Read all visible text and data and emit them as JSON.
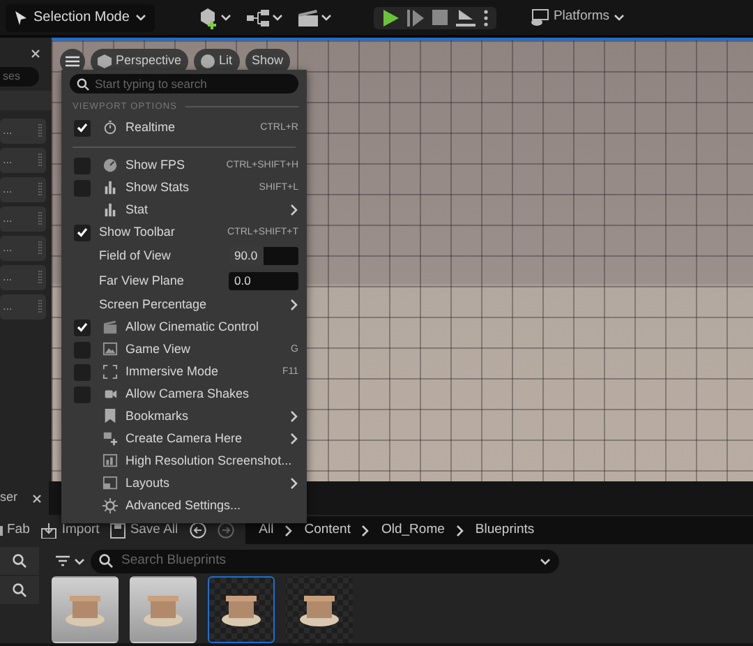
{
  "toolbar": {
    "mode": "Selection Mode",
    "platforms": "Platforms"
  },
  "left_panel": {
    "search_text": "ses",
    "rows": [
      "...",
      "...",
      "...",
      "...",
      "...",
      "...",
      "..."
    ]
  },
  "viewport": {
    "buttons": [
      "Perspective",
      "Lit",
      "Show"
    ]
  },
  "menu": {
    "search_placeholder": "Start typing to search",
    "section": "VIEWPORT OPTIONS",
    "items": [
      {
        "kind": "check",
        "label": "Realtime",
        "checked": true,
        "shortcut": "CTRL+R"
      },
      {
        "kind": "divider"
      },
      {
        "kind": "check",
        "label": "Show FPS",
        "checked": false,
        "shortcut": "CTRL+SHIFT+H"
      },
      {
        "kind": "check",
        "label": "Show Stats",
        "checked": false,
        "shortcut": "SHIFT+L"
      },
      {
        "kind": "submenu",
        "label": "Stat"
      },
      {
        "kind": "check",
        "label": "Show Toolbar",
        "checked": true,
        "shortcut": "CTRL+SHIFT+T"
      },
      {
        "kind": "number",
        "label": "Field of View",
        "value": "90.0",
        "level": 0.5
      },
      {
        "kind": "number",
        "label": "Far View Plane",
        "value": "0.0"
      },
      {
        "kind": "submenu",
        "label": "Screen Percentage"
      },
      {
        "kind": "check",
        "label": "Allow Cinematic Control",
        "checked": true
      },
      {
        "kind": "check",
        "label": "Game View",
        "checked": false,
        "shortcut": "G"
      },
      {
        "kind": "check",
        "label": "Immersive Mode",
        "checked": false,
        "shortcut": "F11"
      },
      {
        "kind": "check",
        "label": "Allow Camera Shakes",
        "checked": false
      },
      {
        "kind": "submenu",
        "label": "Bookmarks"
      },
      {
        "kind": "submenu",
        "label": "Create Camera Here"
      },
      {
        "kind": "action",
        "label": "High Resolution Screenshot..."
      },
      {
        "kind": "submenu",
        "label": "Layouts"
      },
      {
        "kind": "action",
        "label": "Advanced Settings..."
      }
    ]
  },
  "content_browser": {
    "tab": "ser",
    "actions": [
      "Fab",
      "Import",
      "Save All"
    ],
    "breadcrumb": [
      "All",
      "Content",
      "Old_Rome",
      "Blueprints"
    ],
    "search_placeholder": "Search Blueprints",
    "assets": [
      {
        "selected": false
      },
      {
        "selected": false
      },
      {
        "selected": true
      },
      {
        "selected": false
      }
    ]
  }
}
